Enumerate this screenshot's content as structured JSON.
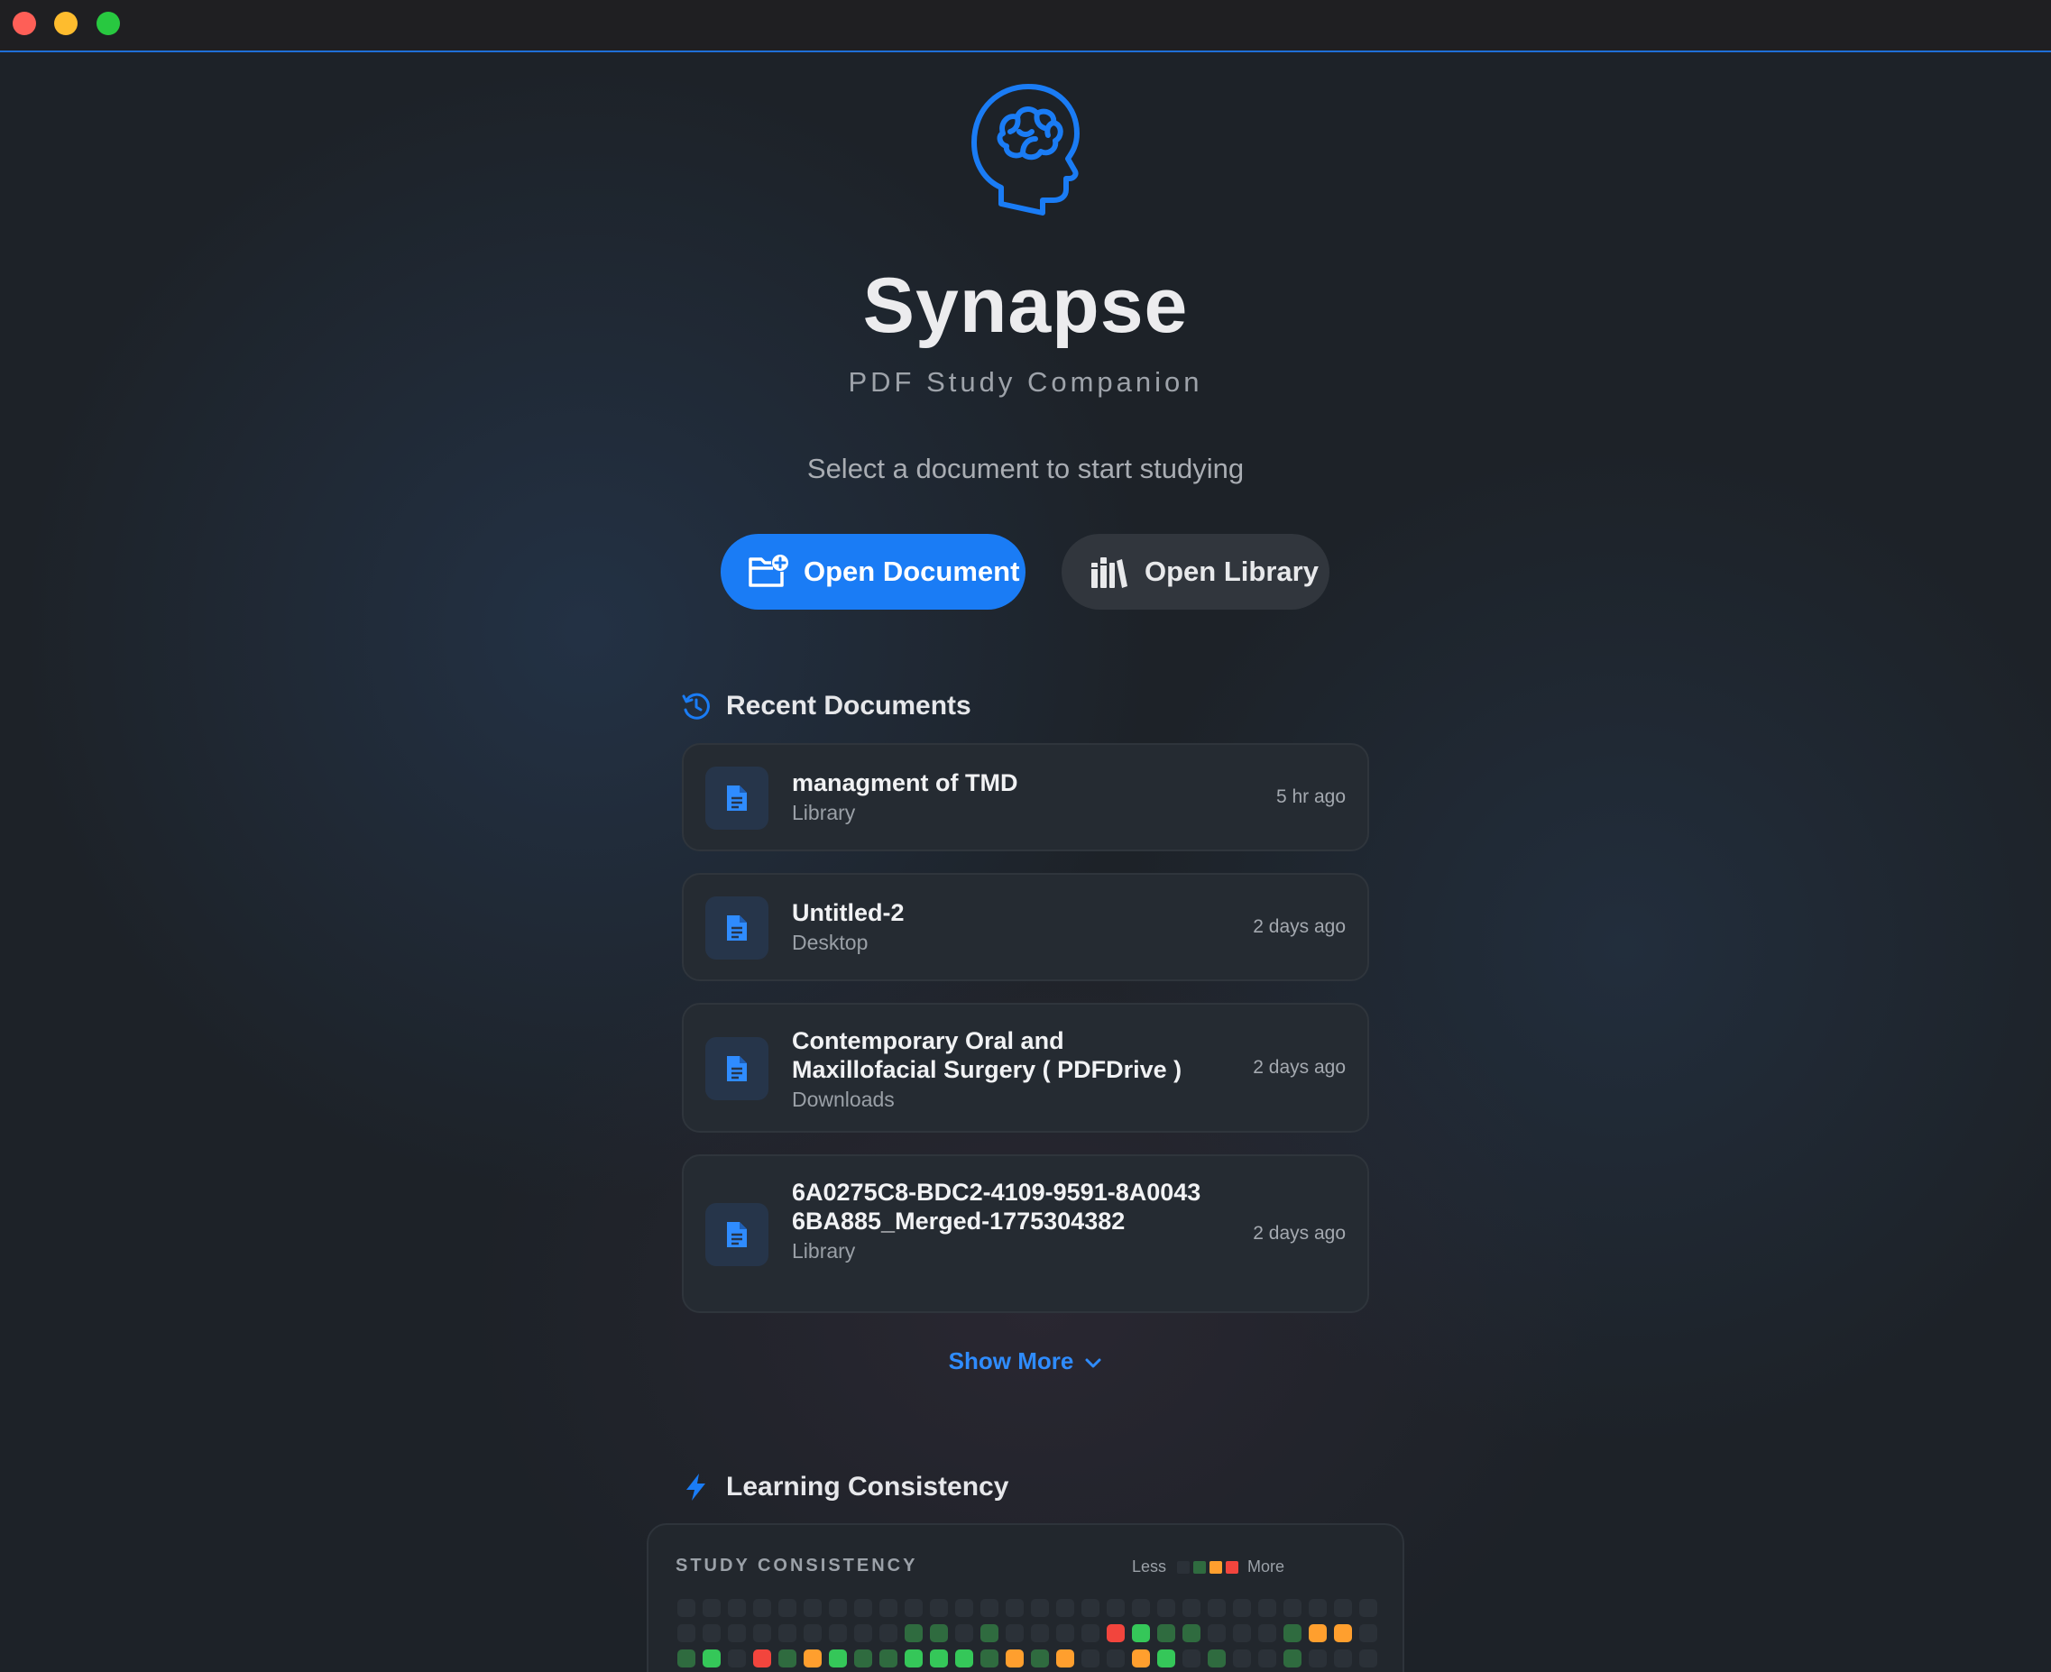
{
  "app": {
    "title": "Synapse",
    "subtitle": "PDF Study Companion",
    "prompt": "Select a document to start studying",
    "logo_icon": "brain-head-icon",
    "accent_color": "#1a7cf5"
  },
  "actions": {
    "open_document": "Open Document",
    "open_library": "Open Library"
  },
  "recent": {
    "heading": "Recent Documents",
    "items": [
      {
        "name": "managment of TMD",
        "location": "Library",
        "time": "5 hr ago"
      },
      {
        "name": "Untitled-2",
        "location": "Desktop",
        "time": "2 days ago"
      },
      {
        "name": "Contemporary Oral and Maxillofacial Surgery ( PDFDrive )",
        "location": "Downloads",
        "time": "2 days ago"
      },
      {
        "name": "6A0275C8-BDC2-4109-9591-8A00436BA885_Merged-1775304382",
        "location": "Library",
        "time": "2 days ago"
      }
    ],
    "show_more": "Show More"
  },
  "consistency": {
    "heading": "Learning Consistency",
    "card_title": "STUDY CONSISTENCY",
    "legend_less": "Less",
    "legend_more": "More",
    "legend_colors": [
      "#2b3138",
      "#2f6b3f",
      "#ff9f2e",
      "#f2453d"
    ],
    "level_colors": {
      "0": "#2b3138",
      "1": "#2f6b3f",
      "2": "#35c759",
      "3": "#ff9f2e",
      "4": "#f2453d"
    },
    "rows": [
      [
        0,
        0,
        0,
        0,
        0,
        0,
        0,
        0,
        0,
        0,
        0,
        0,
        0,
        0,
        0,
        0,
        0,
        0,
        0,
        0,
        0,
        0,
        0,
        0,
        0,
        0,
        0,
        0
      ],
      [
        0,
        0,
        0,
        0,
        0,
        0,
        0,
        0,
        0,
        1,
        1,
        0,
        1,
        0,
        0,
        0,
        0,
        4,
        2,
        1,
        1,
        0,
        0,
        0,
        1,
        3,
        3,
        0
      ],
      [
        1,
        2,
        0,
        4,
        1,
        3,
        2,
        1,
        1,
        2,
        2,
        2,
        1,
        3,
        1,
        3,
        0,
        0,
        3,
        2,
        0,
        1,
        0,
        0,
        1,
        0,
        0,
        0
      ]
    ]
  }
}
